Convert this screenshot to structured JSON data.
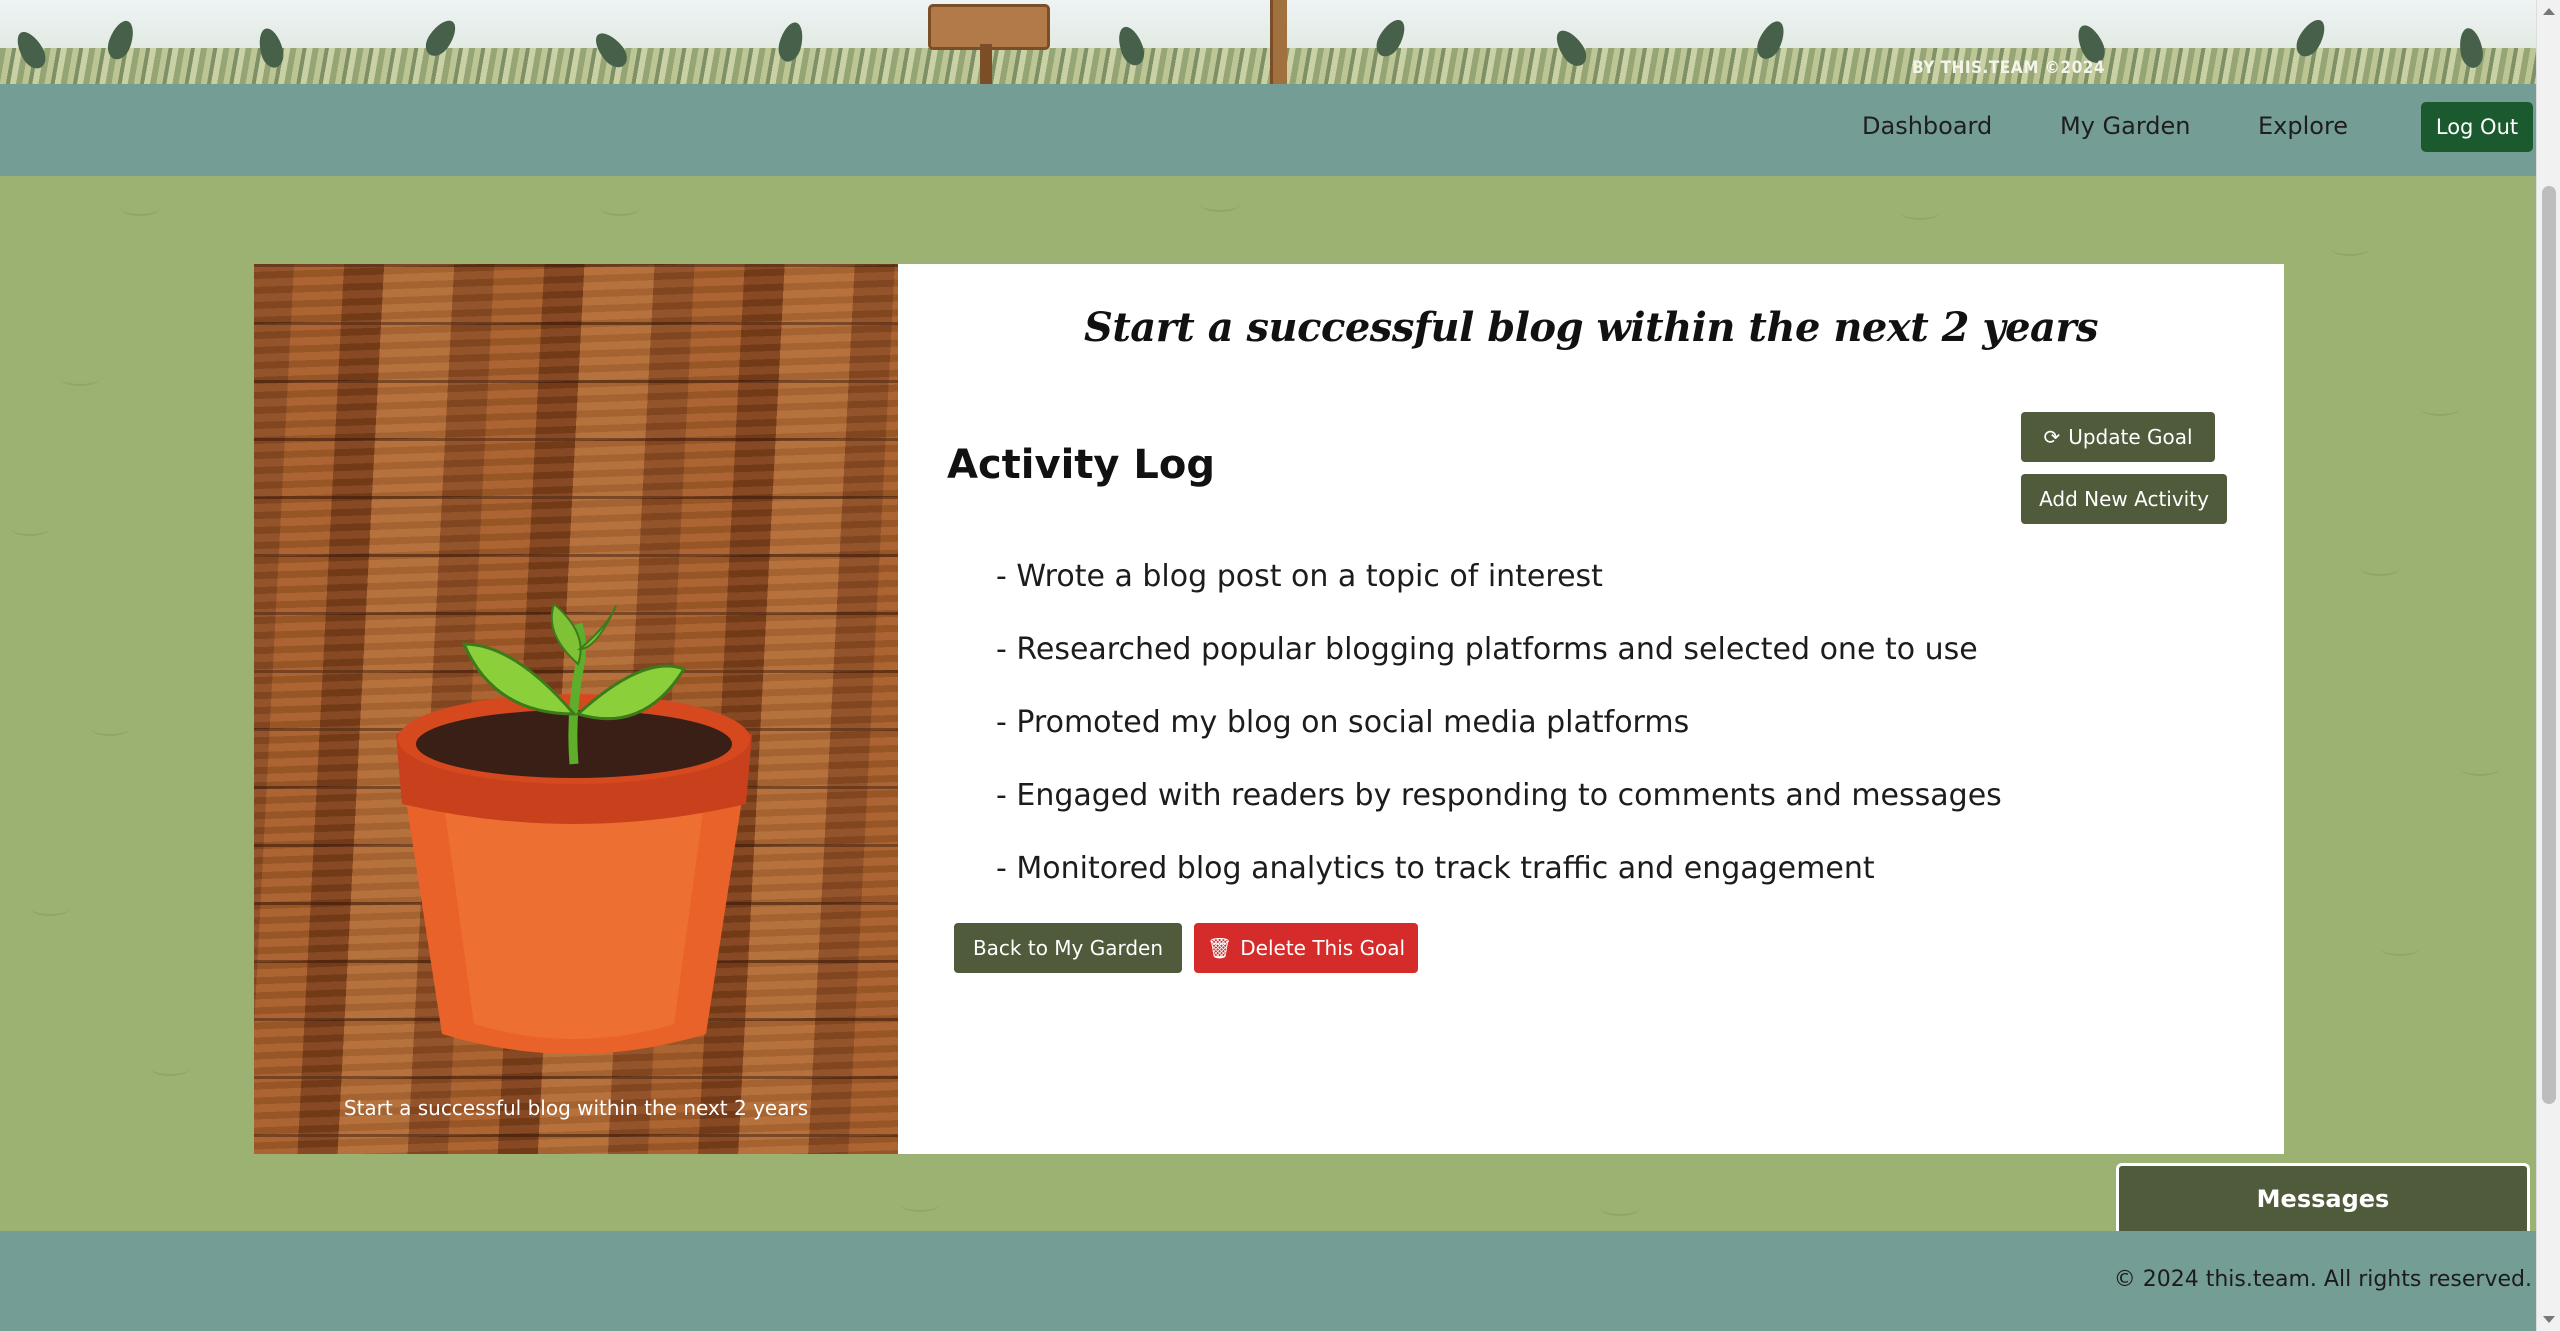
{
  "banner": {
    "credit": "BY THIS.TEAM ©2024"
  },
  "nav": {
    "items": [
      "Dashboard",
      "My Garden",
      "Explore"
    ],
    "logout_label": "Log Out"
  },
  "goal": {
    "title": "Start a successful blog within the next 2 years",
    "image_caption": "Start a successful blog within the next 2 years"
  },
  "actions": {
    "update_label": "Update Goal",
    "add_activity_label": "Add New Activity",
    "back_label": "Back to My Garden",
    "delete_label": "Delete This Goal"
  },
  "activity_log": {
    "heading": "Activity Log",
    "items": [
      "- Wrote a blog post on a topic of interest",
      "- Researched popular blogging platforms and selected one to use",
      "- Promoted my blog on social media platforms",
      "- Engaged with readers by responding to comments and messages",
      "- Monitored blog analytics to track traffic and engagement"
    ]
  },
  "messages": {
    "label": "Messages"
  },
  "footer": {
    "copyright": "© 2024 this.team. All rights reserved."
  },
  "icons": {
    "update": "refresh-icon",
    "delete": "trash-icon"
  },
  "colors": {
    "nav_bg": "#749d96",
    "page_bg": "#9cb273",
    "button_dark": "#4f5b3a",
    "button_red": "#d62b2b",
    "logout_bg": "#1a5a2e"
  }
}
